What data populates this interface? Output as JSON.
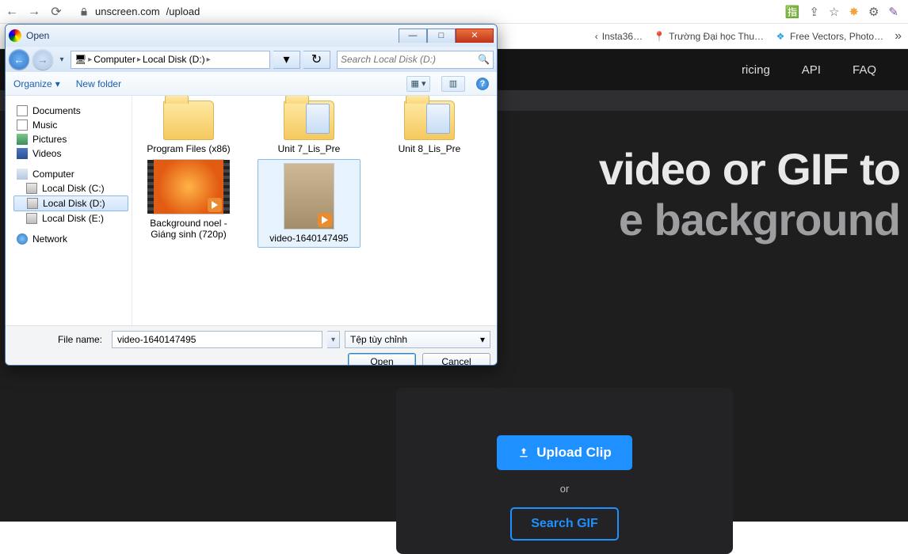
{
  "browser": {
    "url_host": "unscreen.com",
    "url_path": "/upload",
    "bookmarks": {
      "insta": "Insta36…",
      "uni": "Trường Đại học Thu…",
      "vectors": "Free Vectors, Photo…"
    }
  },
  "page": {
    "nav": {
      "pricing": "ricing",
      "api": "API",
      "faq": "FAQ"
    },
    "hero_line1": "video or GIF to",
    "hero_line2": "e background",
    "upload_btn": "Upload Clip",
    "or": "or",
    "search_btn": "Search GIF"
  },
  "dialog": {
    "title": "Open",
    "breadcrumb": {
      "computer": "Computer",
      "disk": "Local Disk (D:)"
    },
    "search_placeholder": "Search Local Disk (D:)",
    "organize": "Organize",
    "new_folder": "New folder",
    "tree": {
      "documents": "Documents",
      "music": "Music",
      "pictures": "Pictures",
      "videos": "Videos",
      "computer": "Computer",
      "disk_c": "Local Disk (C:)",
      "disk_d": "Local Disk (D:)",
      "disk_e": "Local Disk (E:)",
      "network": "Network"
    },
    "items": {
      "program_files": "Program Files (x86)",
      "unit7": "Unit 7_Lis_Pre",
      "unit8": "Unit 8_Lis_Pre",
      "bg_noel": "Background noel - Giáng sinh (720p)",
      "video_sel": "video-1640147495"
    },
    "filename_label": "File name:",
    "filename_value": "video-1640147495",
    "filter_label": "Tệp tùy chỉnh",
    "open_btn": "Open",
    "cancel_btn": "Cancel"
  }
}
